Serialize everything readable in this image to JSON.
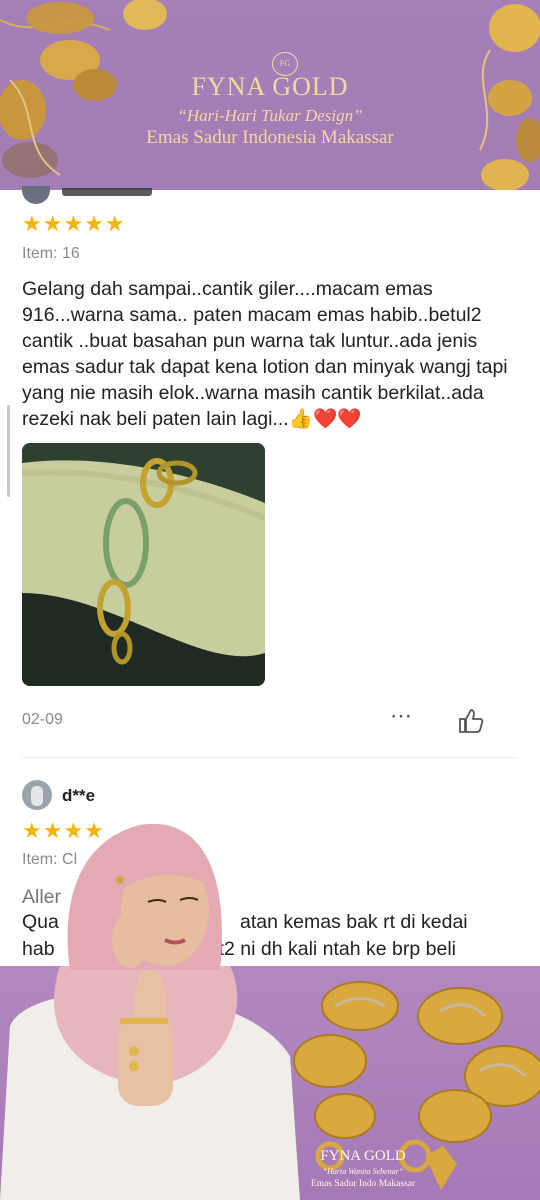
{
  "banner_top": {
    "logo": "FG",
    "brand": "FYNA GOLD",
    "tagline": "“Hari-Hari Tukar Design”",
    "subtitle": "Emas Sadur Indonesia Makassar"
  },
  "review1": {
    "rating": 5,
    "stars": "★★★★★",
    "item": "Item: 16",
    "text": "Gelang dah sampai..cantik giler....macam emas 916...warna sama.. paten macam emas habib..betul2 cantik ..buat basahan pun warna tak luntur..ada jenis emas sadur tak dapat kena lotion dan minyak wangj tapi yang nie masih elok..warna masih cantik berkilat..ada rezeki nak beli paten lain lagi...👍❤️❤️",
    "date": "02-09",
    "more_icon": "ellipsis-icon",
    "like_icon": "thumbs-up-icon"
  },
  "review2": {
    "username": "d**e",
    "stars": "★★★★",
    "item": "Item: Cl",
    "line1": "Aller",
    "line2_a": "Qua",
    "line2_b": "atan kemas bak rt di kedai",
    "line3_a": "hab",
    "line3_b": "sgt2 ni dh kali ntah ke brp beli"
  },
  "banner_bottom": {
    "brand": "FYNA GOLD",
    "tagline": "“Harta Wanita Sebenar”",
    "subtitle": "Emas Sadur Indo Makassar"
  },
  "colors": {
    "banner_purple": "#a57fb8",
    "gold_text": "#f3d9a0",
    "star": "#f5b40c"
  }
}
